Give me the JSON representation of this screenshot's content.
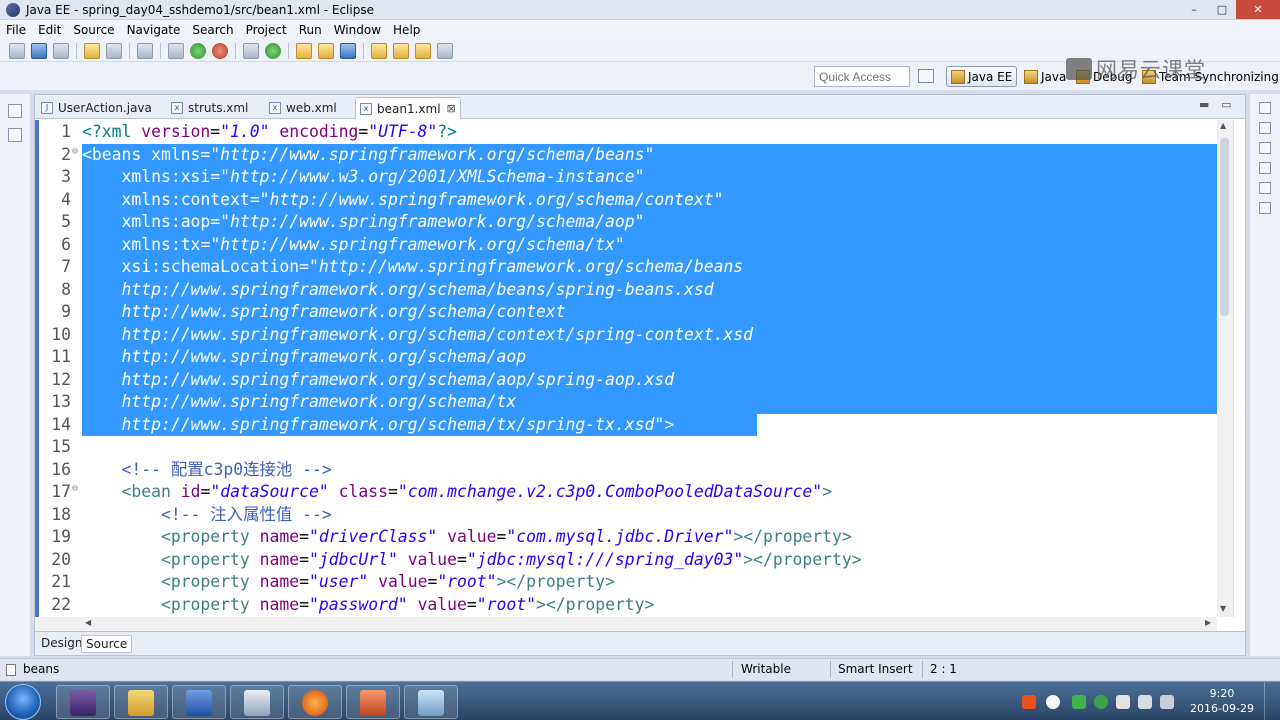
{
  "window": {
    "title": "Java EE - spring_day04_sshdemo1/src/bean1.xml - Eclipse",
    "minimize": "–",
    "maximize": "□",
    "close": "✕"
  },
  "menu": [
    "File",
    "Edit",
    "Source",
    "Navigate",
    "Search",
    "Project",
    "Run",
    "Window",
    "Help"
  ],
  "toolbar_icons": [
    "new-icon",
    "save-icon",
    "print-icon",
    "build-icon",
    "terminal-icon",
    "skip-icon",
    "debug-icon",
    "run-icon",
    "coverage-icon",
    "server-icon",
    "new-class-icon",
    "open-type-icon",
    "search-icon",
    "globe-icon",
    "next-annotation-icon",
    "prev-annotation-icon",
    "back-icon",
    "forward-icon"
  ],
  "perspective": {
    "quick_access_placeholder": "Quick Access",
    "perspectives": [
      {
        "label": "Java EE",
        "active": true
      },
      {
        "label": "Java",
        "active": false
      },
      {
        "label": "Debug",
        "active": false
      },
      {
        "label": "Team Synchronizing",
        "active": false
      }
    ]
  },
  "watermark": "网易云课堂",
  "tabs": [
    {
      "label": "UserAction.java",
      "active": false
    },
    {
      "label": "struts.xml",
      "active": false
    },
    {
      "label": "web.xml",
      "active": false
    },
    {
      "label": "bean1.xml",
      "active": true,
      "close": "⊠"
    }
  ],
  "tabs_controls": {
    "minimize": "▬",
    "maximize": "▭"
  },
  "editor": {
    "selected_lines": [
      2,
      3,
      4,
      5,
      6,
      7,
      8,
      9,
      10,
      11,
      12,
      13,
      14
    ],
    "lines": [
      {
        "n": "1",
        "tokens": [
          [
            "pi",
            "<?xml "
          ],
          [
            "attr",
            "version"
          ],
          [
            "pun",
            "="
          ],
          [
            "val",
            "\"1.0\""
          ],
          [
            "pun",
            " "
          ],
          [
            "attr",
            "encoding"
          ],
          [
            "pun",
            "="
          ],
          [
            "val",
            "\"UTF-8\""
          ],
          [
            "pi",
            "?>"
          ]
        ]
      },
      {
        "n": "2",
        "fold": "⊖",
        "tokens": [
          [
            "tag",
            "<beans "
          ],
          [
            "attr",
            "xmlns"
          ],
          [
            "pun",
            "="
          ],
          [
            "val",
            "\"http://www.springframework.org/schema/beans\""
          ]
        ]
      },
      {
        "n": "3",
        "tokens": [
          [
            "pun",
            "    "
          ],
          [
            "attr",
            "xmlns:xsi"
          ],
          [
            "pun",
            "="
          ],
          [
            "val",
            "\"http://www.w3.org/2001/XMLSchema-instance\""
          ]
        ]
      },
      {
        "n": "4",
        "tokens": [
          [
            "pun",
            "    "
          ],
          [
            "attr",
            "xmlns:context"
          ],
          [
            "pun",
            "="
          ],
          [
            "val",
            "\"http://www.springframework.org/schema/context\""
          ]
        ]
      },
      {
        "n": "5",
        "tokens": [
          [
            "pun",
            "    "
          ],
          [
            "attr",
            "xmlns:aop"
          ],
          [
            "pun",
            "="
          ],
          [
            "val",
            "\"http://www.springframework.org/schema/aop\""
          ]
        ]
      },
      {
        "n": "6",
        "tokens": [
          [
            "pun",
            "    "
          ],
          [
            "attr",
            "xmlns:tx"
          ],
          [
            "pun",
            "="
          ],
          [
            "val",
            "\"http://www.springframework.org/schema/tx\""
          ]
        ]
      },
      {
        "n": "7",
        "tokens": [
          [
            "pun",
            "    "
          ],
          [
            "attr",
            "xsi:schemaLocation"
          ],
          [
            "pun",
            "="
          ],
          [
            "val",
            "\"http://www.springframework.org/schema/beans"
          ]
        ]
      },
      {
        "n": "8",
        "tokens": [
          [
            "pun",
            "    "
          ],
          [
            "val",
            "http://www.springframework.org/schema/beans/spring-beans.xsd"
          ]
        ]
      },
      {
        "n": "9",
        "tokens": [
          [
            "pun",
            "    "
          ],
          [
            "val",
            "http://www.springframework.org/schema/context"
          ]
        ]
      },
      {
        "n": "10",
        "tokens": [
          [
            "pun",
            "    "
          ],
          [
            "val",
            "http://www.springframework.org/schema/context/spring-context.xsd"
          ]
        ]
      },
      {
        "n": "11",
        "tokens": [
          [
            "pun",
            "    "
          ],
          [
            "val",
            "http://www.springframework.org/schema/aop"
          ]
        ]
      },
      {
        "n": "12",
        "tokens": [
          [
            "pun",
            "    "
          ],
          [
            "val",
            "http://www.springframework.org/schema/aop/spring-aop.xsd"
          ]
        ]
      },
      {
        "n": "13",
        "tokens": [
          [
            "pun",
            "    "
          ],
          [
            "val",
            "http://www.springframework.org/schema/tx"
          ]
        ]
      },
      {
        "n": "14",
        "tokens": [
          [
            "pun",
            "    "
          ],
          [
            "val",
            "http://www.springframework.org/schema/tx/spring-tx.xsd\""
          ],
          [
            "tag",
            ">"
          ]
        ]
      },
      {
        "n": "15",
        "tokens": []
      },
      {
        "n": "16",
        "tokens": [
          [
            "pun",
            "    "
          ],
          [
            "com",
            "<!-- 配置c3p0连接池 -->"
          ]
        ]
      },
      {
        "n": "17",
        "fold": "⊖",
        "tokens": [
          [
            "pun",
            "    "
          ],
          [
            "tag",
            "<bean "
          ],
          [
            "attr",
            "id"
          ],
          [
            "pun",
            "="
          ],
          [
            "val",
            "\"dataSource\""
          ],
          [
            "pun",
            " "
          ],
          [
            "attr",
            "class"
          ],
          [
            "pun",
            "="
          ],
          [
            "val",
            "\"com.mchange.v2.c3p0.ComboPooledDataSource\""
          ],
          [
            "tag",
            ">"
          ]
        ]
      },
      {
        "n": "18",
        "tokens": [
          [
            "pun",
            "        "
          ],
          [
            "com",
            "<!-- 注入属性值 -->"
          ]
        ]
      },
      {
        "n": "19",
        "tokens": [
          [
            "pun",
            "        "
          ],
          [
            "tag",
            "<property "
          ],
          [
            "attr",
            "name"
          ],
          [
            "pun",
            "="
          ],
          [
            "val",
            "\"driverClass\""
          ],
          [
            "pun",
            " "
          ],
          [
            "attr",
            "value"
          ],
          [
            "pun",
            "="
          ],
          [
            "val",
            "\"com.mysql.jdbc.Driver\""
          ],
          [
            "tag",
            "></property>"
          ]
        ]
      },
      {
        "n": "20",
        "tokens": [
          [
            "pun",
            "        "
          ],
          [
            "tag",
            "<property "
          ],
          [
            "attr",
            "name"
          ],
          [
            "pun",
            "="
          ],
          [
            "val",
            "\"jdbcUrl\""
          ],
          [
            "pun",
            " "
          ],
          [
            "attr",
            "value"
          ],
          [
            "pun",
            "="
          ],
          [
            "val",
            "\"jdbc:mysql:///spring_day03\""
          ],
          [
            "tag",
            "></property>"
          ]
        ]
      },
      {
        "n": "21",
        "tokens": [
          [
            "pun",
            "        "
          ],
          [
            "tag",
            "<property "
          ],
          [
            "attr",
            "name"
          ],
          [
            "pun",
            "="
          ],
          [
            "val",
            "\"user\""
          ],
          [
            "pun",
            " "
          ],
          [
            "attr",
            "value"
          ],
          [
            "pun",
            "="
          ],
          [
            "val",
            "\"root\""
          ],
          [
            "tag",
            "></property>"
          ]
        ]
      },
      {
        "n": "22",
        "tokens": [
          [
            "pun",
            "        "
          ],
          [
            "tag",
            "<property "
          ],
          [
            "attr",
            "name"
          ],
          [
            "pun",
            "="
          ],
          [
            "val",
            "\"password\""
          ],
          [
            "pun",
            " "
          ],
          [
            "attr",
            "value"
          ],
          [
            "pun",
            "="
          ],
          [
            "val",
            "\"root\""
          ],
          [
            "tag",
            "></property>"
          ]
        ]
      }
    ]
  },
  "scroll_arrows": {
    "up": "▲",
    "down": "▼",
    "left": "◀",
    "right": "▶"
  },
  "bottom_tabs": [
    {
      "label": "Design",
      "active": false
    },
    {
      "label": "Source",
      "active": true
    }
  ],
  "status": {
    "breadcrumb": "beans",
    "writable": "Writable",
    "insert_mode": "Smart Insert",
    "cursor": "2 : 1"
  },
  "taskbar": {
    "apps": [
      "eclipse-icon",
      "file-explorer-icon",
      "word-icon",
      "editor-icon",
      "firefox-icon",
      "powerpoint-icon",
      "paint-icon"
    ],
    "clock_time": "9:20",
    "clock_date": "2016-09-29"
  }
}
